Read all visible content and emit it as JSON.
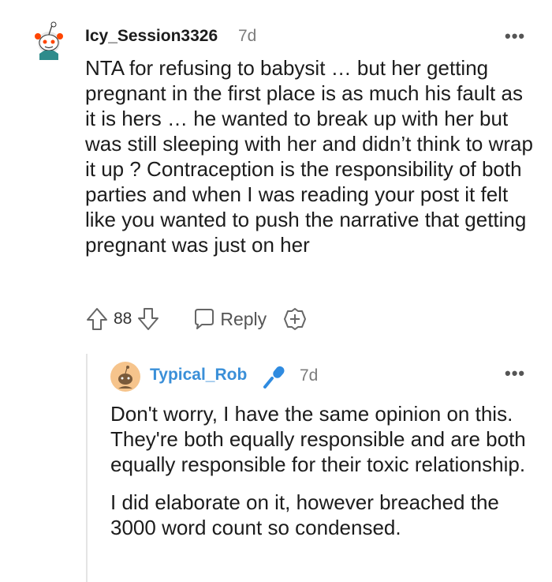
{
  "comment": {
    "username": "Icy_Session3326",
    "age": "7d",
    "more_label": "•••",
    "body": "NTA for refusing to babysit … but her getting pregnant in the first place is as much his fault as it is hers … he wanted to break up with her but was still sleeping with her and didn’t think to wrap it up ? Contraception is the responsibility of both parties and when I was reading your post it felt like you wanted to push the narrative that getting pregnant was just on her",
    "votes": "88",
    "reply_label": "Reply"
  },
  "reply": {
    "username": "Typical_Rob",
    "age": "7d",
    "more_label": "•••",
    "paragraphs": [
      "Don't worry, I have the same opinion on this. They're both equally responsible and are both equally responsible for their toxic relationship.",
      "I did elaborate on it, however breached the 3000 word count so condensed."
    ]
  },
  "colors": {
    "username_reply": "#3a8fd8",
    "meta": "#7c7c7c",
    "text": "#1c1c1c"
  },
  "icons": [
    "snoo-avatar-icon",
    "upvote-icon",
    "downvote-icon",
    "reply-icon",
    "award-icon",
    "more-icon",
    "snoo-avatar-icon",
    "microphone-icon"
  ]
}
